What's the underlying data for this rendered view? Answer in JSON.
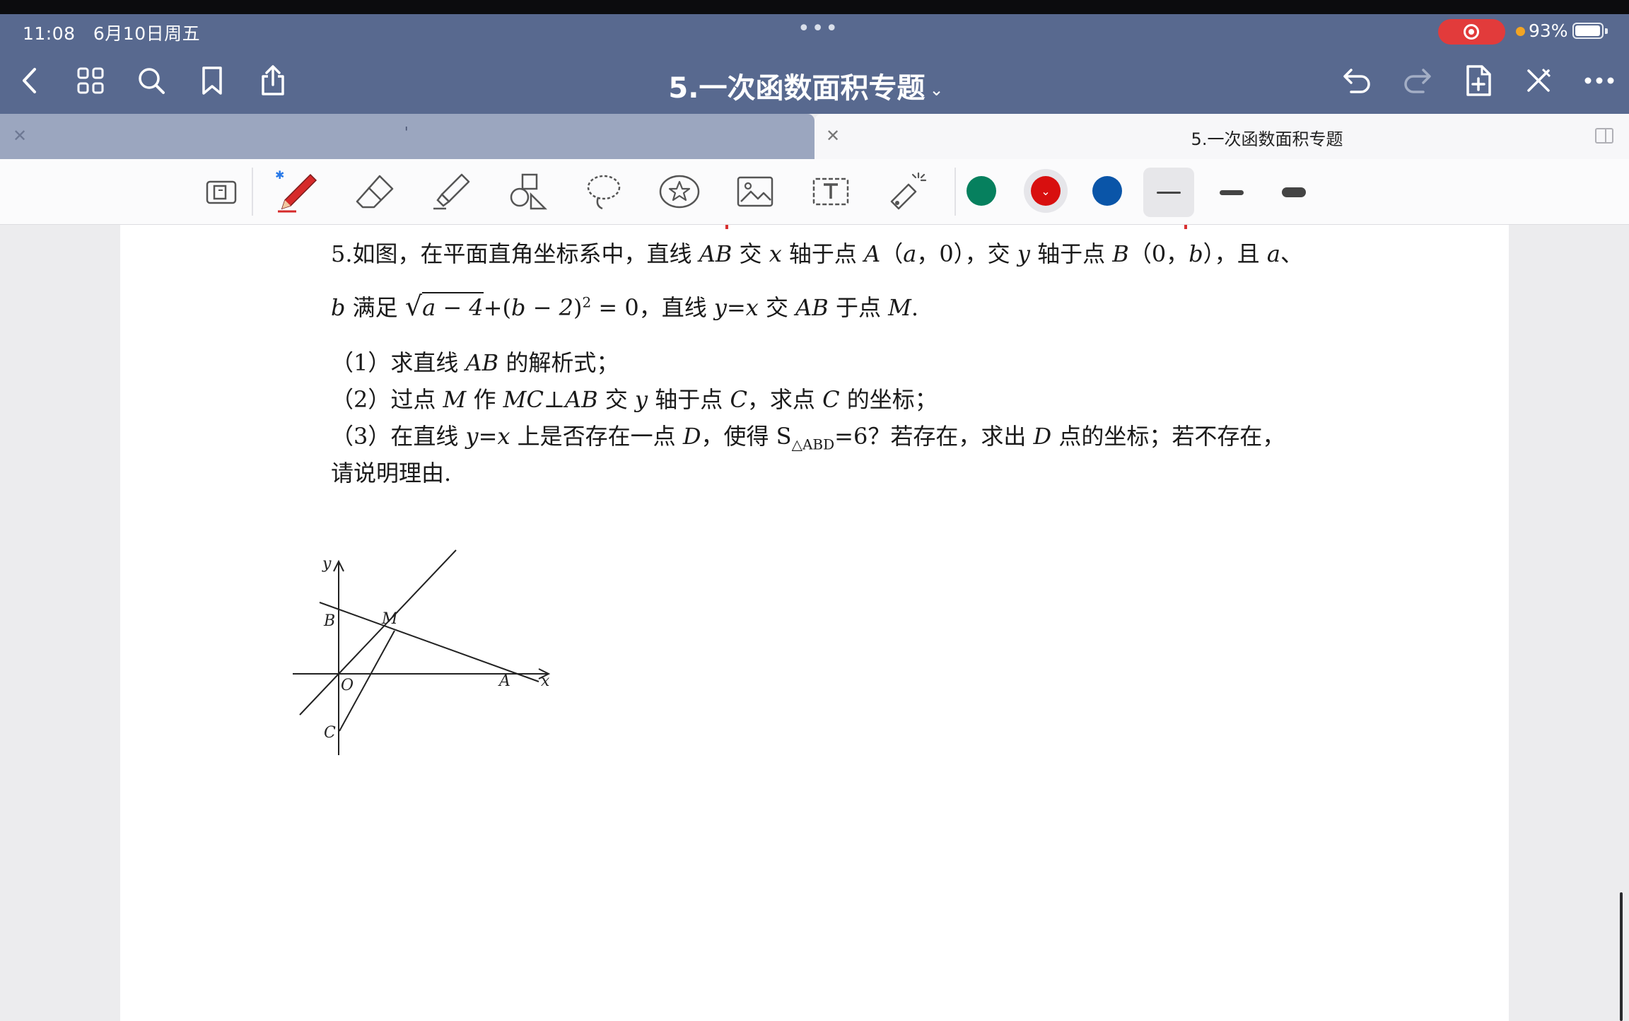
{
  "status": {
    "time": "11:08",
    "date": "6月10日周五",
    "battery": "93%"
  },
  "header": {
    "title": "5.一次函数面积专题"
  },
  "tabs": [
    {
      "label": "'"
    },
    {
      "label": "5.一次函数面积专题"
    }
  ],
  "colors": {
    "nav_bar": "#58698f",
    "swatch_green": "#06805e",
    "swatch_red": "#d80f0f",
    "swatch_blue": "#0a55a8"
  },
  "toolbar_tools": [
    "page-view-icon",
    "pen-icon",
    "eraser-icon",
    "highlighter-icon",
    "shapes-icon",
    "lasso-icon",
    "sticker-icon",
    "image-icon",
    "text-box-icon",
    "laser-pointer-icon"
  ],
  "problem": {
    "line1_a": "5.如图，在平面直角坐标系中，直线",
    "line1_b": "交",
    "line1_c": "轴于点",
    "line1_d": "，0），交",
    "line1_e": "轴于点",
    "line1_f": "（0，",
    "line1_g": "），且",
    "line1_h": "、",
    "v_AB": "AB",
    "v_x": "x",
    "v_y": "y",
    "v_A": "A",
    "v_a": "a",
    "v_B": "B",
    "v_b": "b",
    "v_M": "M",
    "v_C": "C",
    "v_D": "D",
    "paren_open": "（",
    "line2_a": "满足",
    "line2_sqrt": "a − 4",
    "line2_plus": "+(",
    "line2_bm2": "b − 2",
    "line2_close": ")",
    "line2_exp": "2",
    "line2_eq": "= 0，直线",
    "line2_yx": "y=x",
    "line2_b": "交",
    "line2_c": "于点",
    "period": ".",
    "q1_a": "（1）求直线",
    "q1_b": "的解析式；",
    "q2_a": "（2）过点",
    "q2_b": "作",
    "q2_mc": "MC",
    "q2_perp": "⊥",
    "q2_c": "交",
    "q2_d": "轴于点",
    "q2_e": "，求点",
    "q2_f": "的坐标；",
    "q3_a": "（3）在直线",
    "q3_b": "上是否存在一点",
    "q3_c": "，使得 S",
    "q3_sub": "△ABD",
    "q3_d": "=6？若存在，求出",
    "q3_e": "点的坐标；若不存在，",
    "q3_line2": "请说明理由."
  },
  "figure_labels": {
    "y": "y",
    "x": "x",
    "B": "B",
    "M": "M",
    "O": "O",
    "A": "A",
    "C": "C"
  }
}
